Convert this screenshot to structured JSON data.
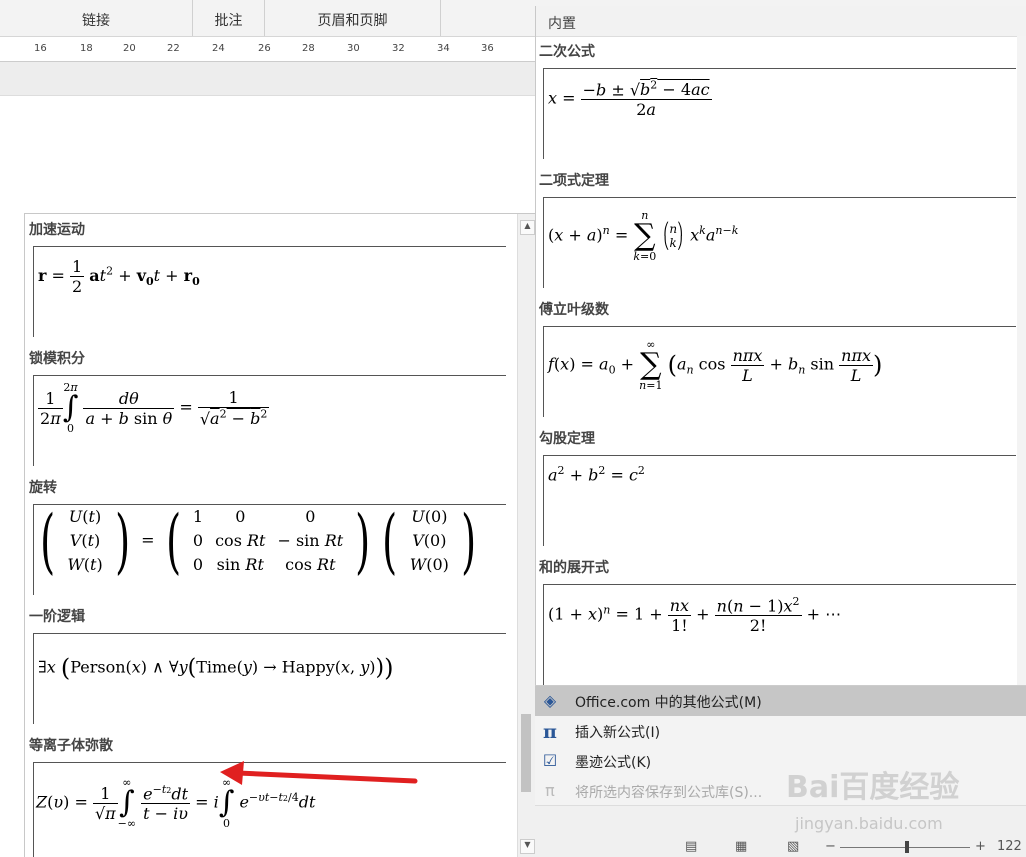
{
  "ribbon": {
    "groups": [
      {
        "label": "链接"
      },
      {
        "label": "批注"
      },
      {
        "label": "页眉和页脚"
      }
    ]
  },
  "ruler": {
    "ticks": [
      "16",
      "18",
      "20",
      "22",
      "24",
      "26",
      "28",
      "30",
      "32",
      "34",
      "36"
    ]
  },
  "left_gallery": {
    "sections": [
      {
        "title": "加速运动"
      },
      {
        "title": "锁模积分"
      },
      {
        "title": "旋转"
      },
      {
        "title": "一阶逻辑"
      },
      {
        "title": "等离子体弥散"
      }
    ]
  },
  "right_gallery": {
    "header": "内置",
    "sections": [
      {
        "title": "二次公式"
      },
      {
        "title": "二项式定理"
      },
      {
        "title": "傅立叶级数"
      },
      {
        "title": "勾股定理"
      },
      {
        "title": "和的展开式"
      }
    ]
  },
  "menu": {
    "items": [
      {
        "label": "Office.com 中的其他公式(M)",
        "icon": "office-icon"
      },
      {
        "label": "插入新公式(I)",
        "icon": "pi-icon"
      },
      {
        "label": "墨迹公式(K)",
        "icon": "ink-equation-icon"
      },
      {
        "label": "将所选内容保存到公式库(S)...",
        "icon": "save-to-gallery-icon"
      }
    ]
  },
  "status": {
    "zoom": "122"
  },
  "watermark": {
    "brand": "Bai百度经验",
    "url": "jingyan.baidu.com"
  },
  "colors": {
    "arrow": "#e02020",
    "highlight": "#c6c6c6"
  }
}
